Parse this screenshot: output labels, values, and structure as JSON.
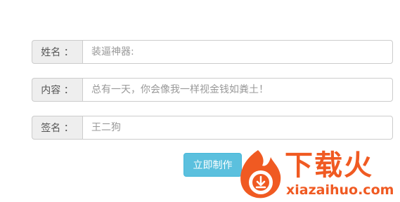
{
  "form": {
    "name": {
      "label": "姓名 ：",
      "placeholder": "装逼神器:"
    },
    "content": {
      "label": "内容 ：",
      "placeholder": "总有一天，你会像我一样视金钱如粪土！"
    },
    "signature": {
      "label": "签名 ：",
      "placeholder": "王二狗"
    },
    "submit_label": "立即制作"
  },
  "watermark": {
    "brand": "下载火",
    "domain": "xiazaihuo.com"
  },
  "colors": {
    "button": "#5bc0de",
    "label_bg": "#eeeeee",
    "border": "#cccccc",
    "watermark": "#f05a22"
  }
}
